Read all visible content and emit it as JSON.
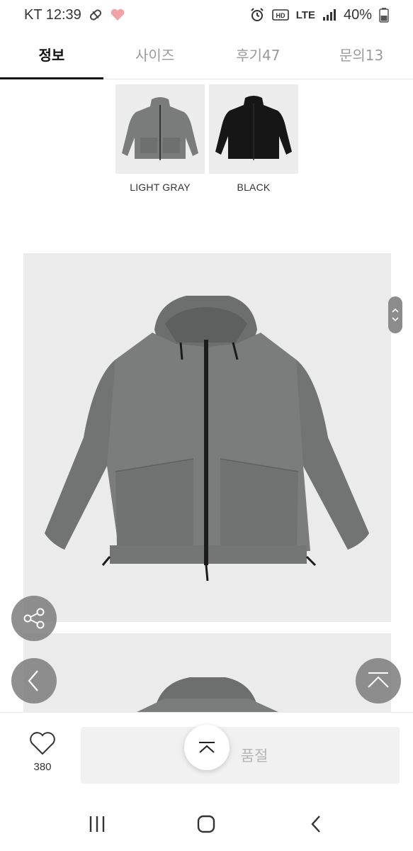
{
  "status_bar": {
    "carrier_time": "KT 12:39",
    "network": "LTE",
    "battery": "40%",
    "icons": [
      "pill-icon",
      "heart-icon",
      "alarm-icon",
      "hd-icon",
      "signal-icon",
      "battery-icon"
    ]
  },
  "tabs": [
    {
      "label": "정보",
      "active": true
    },
    {
      "label": "사이즈",
      "active": false
    },
    {
      "label": "후기47",
      "active": false
    },
    {
      "label": "문의13",
      "active": false
    }
  ],
  "colors": [
    {
      "label": "LIGHT GRAY",
      "color": "#7a7c7c"
    },
    {
      "label": "BLACK",
      "color": "#161616"
    }
  ],
  "bottom_bar": {
    "like_count": "380",
    "soldout_label": "품절"
  },
  "theme": {
    "jacket_gray": "#7b7d7d",
    "fab_gray": "#7a7a7a"
  }
}
